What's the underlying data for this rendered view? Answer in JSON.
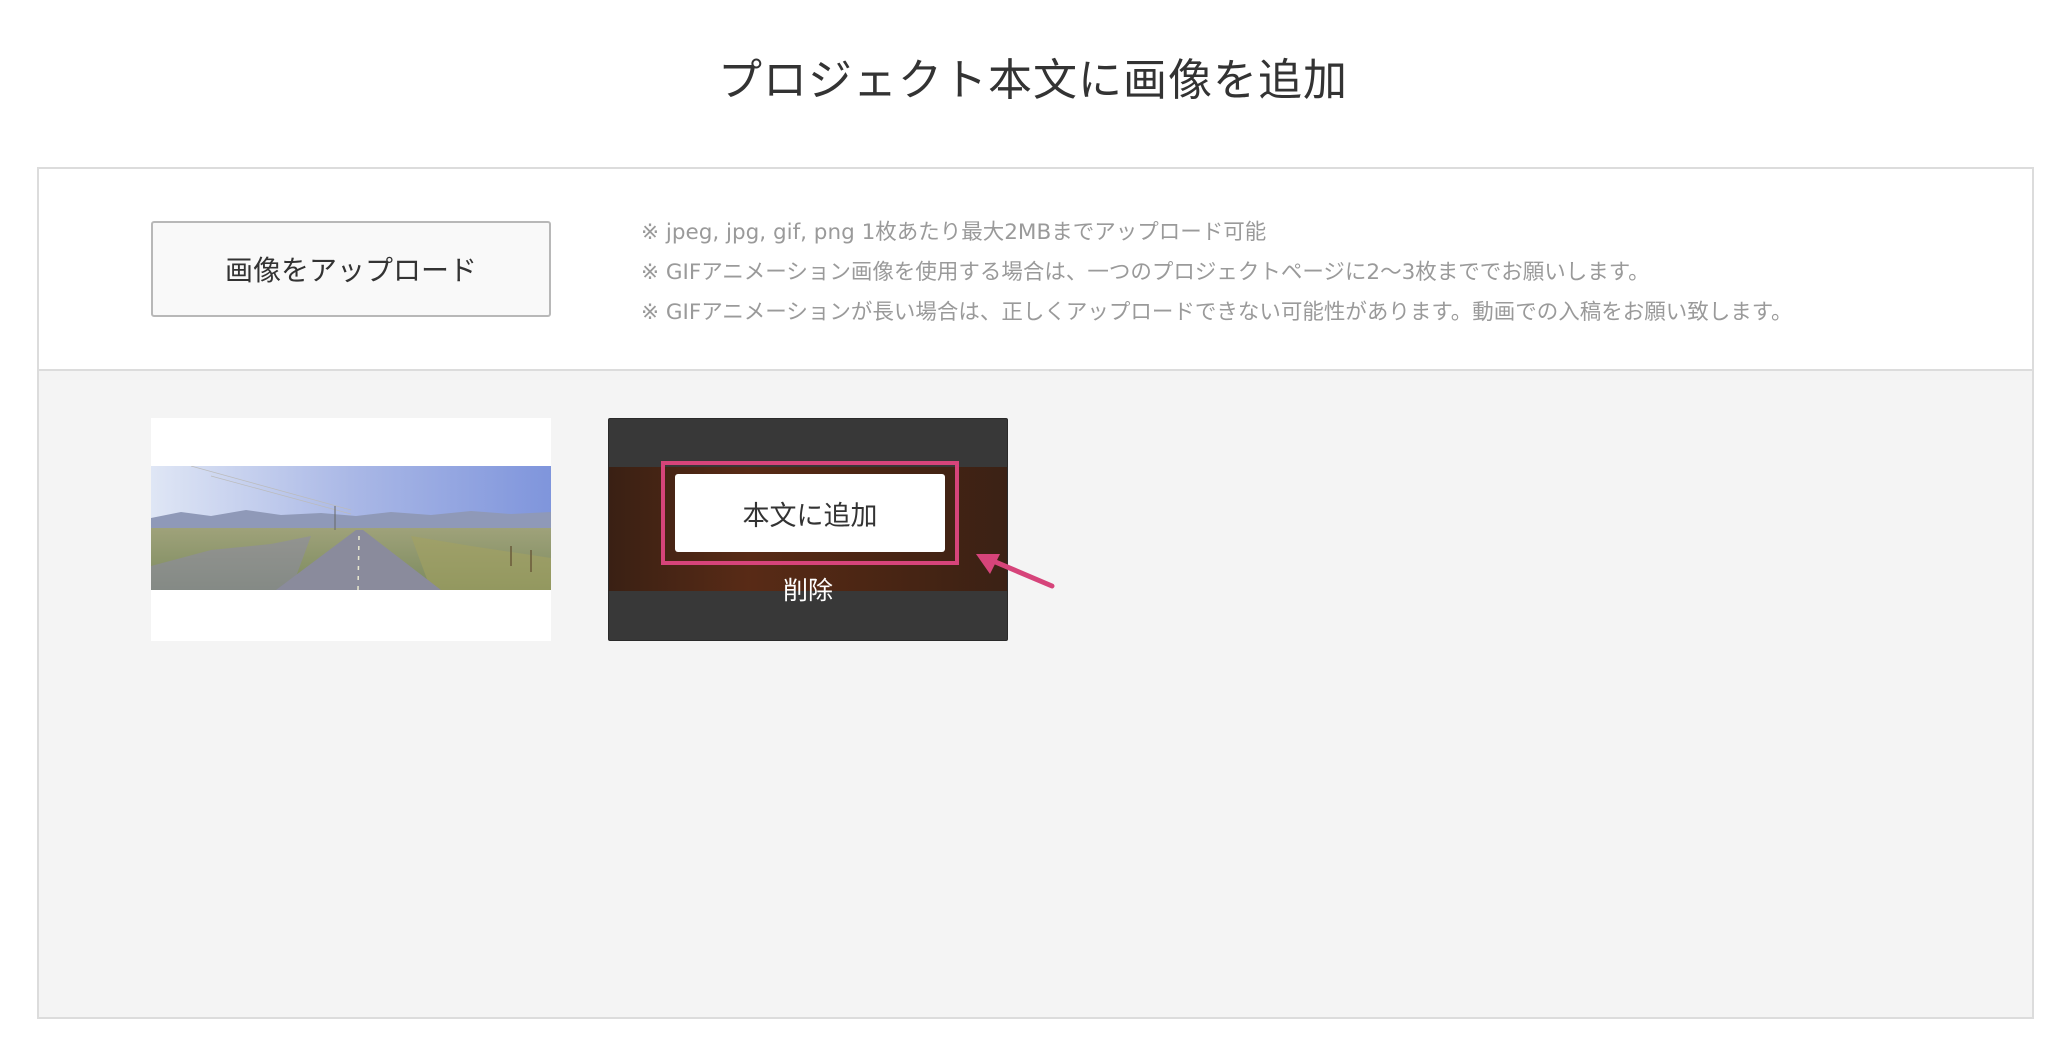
{
  "page": {
    "title": "プロジェクト本文に画像を追加"
  },
  "upload": {
    "button_label": "画像をアップロード",
    "notes": [
      "※ jpeg, jpg, gif, png 1枚あたり最大2MBまでアップロード可能",
      "※ GIFアニメーション画像を使用する場合は、一つのプロジェクトページに2〜3枚まででお願いします。",
      "※ GIFアニメーションが長い場合は、正しくアップロードできない可能性があります。動画での入稿をお願い致します。"
    ]
  },
  "images": {
    "selected": {
      "add_label": "本文に追加",
      "delete_label": "削除"
    }
  },
  "colors": {
    "highlight": "#d6447a",
    "panel_bg": "#f4f4f4",
    "overlay_bg": "#383838"
  }
}
